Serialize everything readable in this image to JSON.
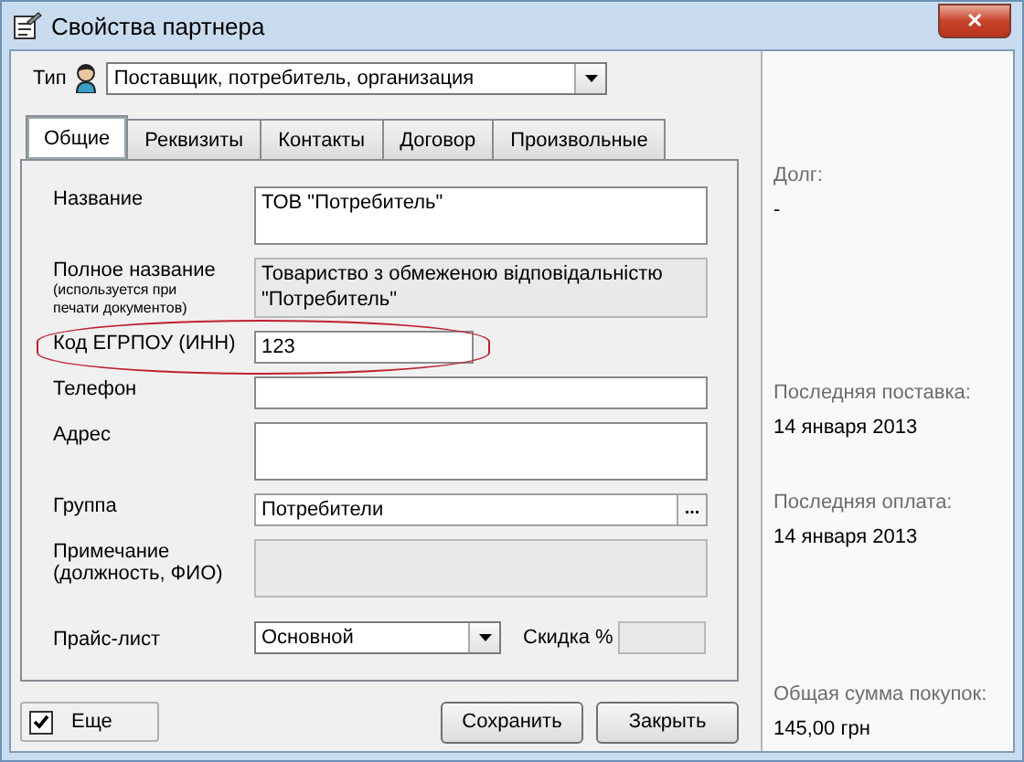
{
  "window": {
    "title": "Свойства партнера",
    "close_label": "✕"
  },
  "type_field": {
    "label": "Тип",
    "value": "Поставщик, потребитель, организация"
  },
  "tabs": [
    {
      "label": "Общие",
      "selected": true
    },
    {
      "label": "Реквизиты",
      "selected": false
    },
    {
      "label": "Контакты",
      "selected": false
    },
    {
      "label": "Договор",
      "selected": false
    },
    {
      "label": "Произвольные",
      "selected": false
    }
  ],
  "fields": [
    {
      "kind": "multiline",
      "label": "Название",
      "value": "ТОВ \"Потребитель\"",
      "readonly": false
    },
    {
      "kind": "multiline",
      "label": "Полное название",
      "hint": "(используется при печати документов)",
      "value": "Товариство з обмеженою відповідальністю \"Потребитель\"",
      "readonly": true
    },
    {
      "kind": "short",
      "label": "Код ЕГРПОУ (ИНН)",
      "value": "123",
      "readonly": false,
      "highlighted": true
    },
    {
      "kind": "text",
      "label": "Телефон",
      "readonly": false
    },
    {
      "kind": "multiline",
      "label": "Адрес",
      "readonly": false
    },
    {
      "kind": "picker",
      "label": "Группа",
      "value": "Потребители",
      "button": "..."
    },
    {
      "kind": "multiline",
      "label": "Примечание (должность, ФИО)",
      "readonly": true
    }
  ],
  "price_list": {
    "label": "Прайс-лист",
    "value": "Основной"
  },
  "discount": {
    "label": "Скидка %",
    "readonly": true
  },
  "more_checkbox": {
    "label": "Еще",
    "checked": true
  },
  "buttons": [
    "Сохранить",
    "Закрыть"
  ],
  "summary": [
    {
      "label": "Долг:",
      "value": "-"
    },
    {
      "label": "Последняя поставка:",
      "value": "14 января 2013"
    },
    {
      "label": "Последняя оплата:",
      "value": "14 января 2013"
    },
    {
      "label": "Общая сумма покупок:",
      "value": "145,00 грн"
    }
  ]
}
